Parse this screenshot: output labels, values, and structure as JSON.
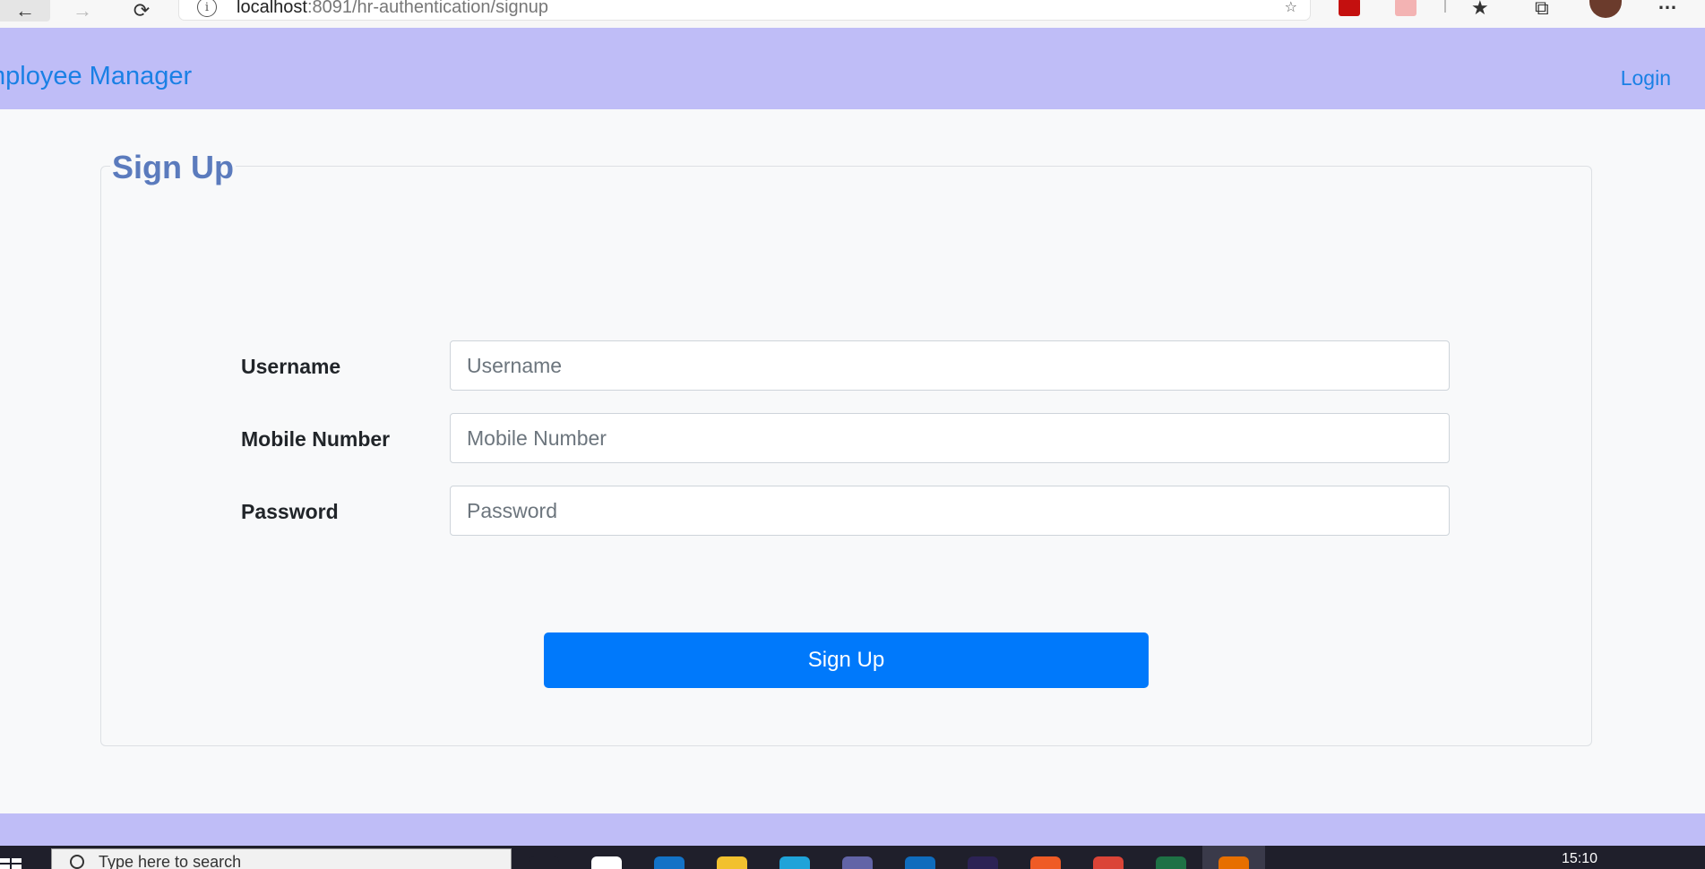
{
  "browser": {
    "url_host": "localhost",
    "url_rest": ":8091/hr-authentication/signup"
  },
  "navbar": {
    "brand": "mployee Manager",
    "login": "Login"
  },
  "form": {
    "legend": "Sign Up",
    "fields": [
      {
        "label": "Username",
        "placeholder": "Username",
        "value": ""
      },
      {
        "label": "Mobile Number",
        "placeholder": "Mobile Number",
        "value": ""
      },
      {
        "label": "Password",
        "placeholder": "Password",
        "value": ""
      }
    ],
    "submit": "Sign Up"
  },
  "taskbar": {
    "search_placeholder": "Type here to search",
    "clock": "15:10",
    "apps": [
      {
        "name": "task-view-icon",
        "color": "#1f1f2b"
      },
      {
        "name": "store-icon",
        "color": "#ffffff"
      },
      {
        "name": "mail-icon",
        "color": "#1372c6"
      },
      {
        "name": "file-explorer-icon",
        "color": "#f2c12e"
      },
      {
        "name": "edge-icon",
        "color": "#1fa3d9"
      },
      {
        "name": "teams-icon",
        "color": "#6264a7"
      },
      {
        "name": "outlook-icon",
        "color": "#0f6cbd"
      },
      {
        "name": "eclipse-icon",
        "color": "#2c2255"
      },
      {
        "name": "postman-icon",
        "color": "#ef5b25"
      },
      {
        "name": "chrome-icon",
        "color": "#db4437"
      },
      {
        "name": "excel-icon",
        "color": "#1e7145"
      },
      {
        "name": "java-icon",
        "color": "#e76f00"
      }
    ]
  },
  "colors": {
    "navbar_bg": "#bfbdf7",
    "brand_link": "#1a80e5",
    "legend": "#5b7bbd",
    "primary_button": "#0079fb"
  }
}
